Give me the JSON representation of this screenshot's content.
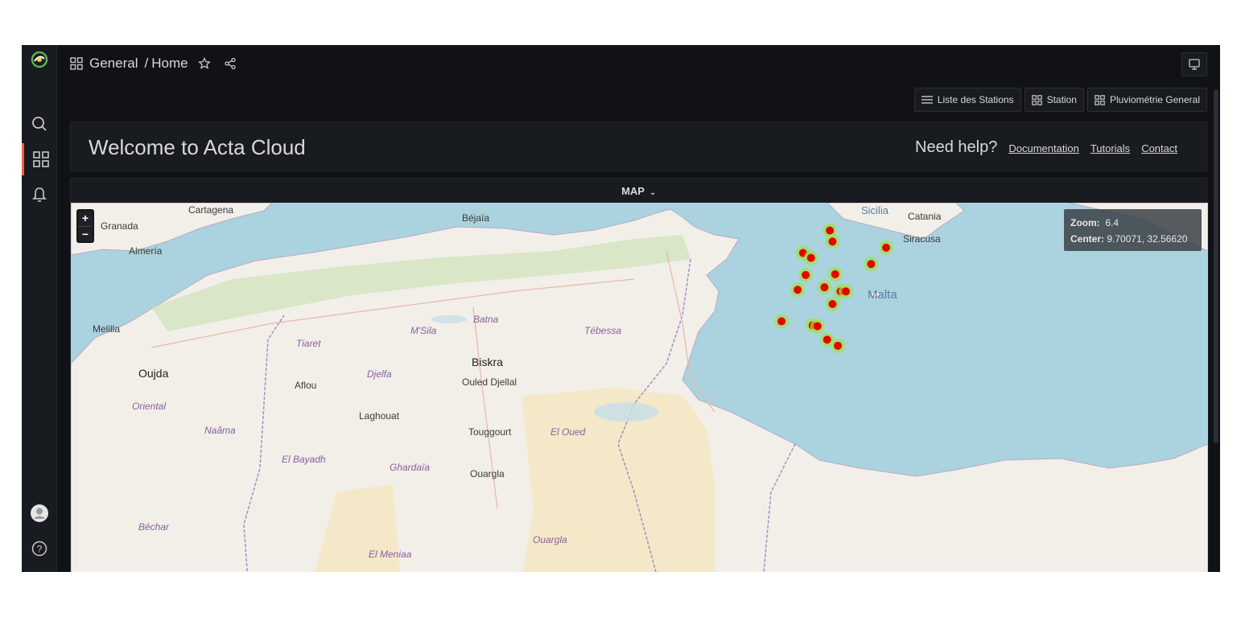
{
  "breadcrumb": {
    "folder": "General",
    "separator": "/",
    "page": "Home"
  },
  "dashlinks": [
    {
      "label": "Liste des Stations",
      "icon": "list-icon"
    },
    {
      "label": "Station",
      "icon": "apps-icon"
    },
    {
      "label": "Pluviométrie General",
      "icon": "apps-icon"
    }
  ],
  "welcome": {
    "title": "Welcome to Acta Cloud",
    "help_label": "Need help?",
    "links": [
      "Documentation",
      "Tutorials",
      "Contact"
    ]
  },
  "map_panel": {
    "title": "MAP",
    "zoom_in": "+",
    "zoom_out": "−",
    "zoom_label": "Zoom:",
    "zoom_value": "6.4",
    "center_label": "Center:",
    "center_value": "9.70071, 32.56620"
  },
  "map_labels": {
    "granada": "Granada",
    "cartagena": "Cartagena",
    "almeria": "Almería",
    "melilla": "Melilla",
    "bejaia": "Béjaïa",
    "biskra": "Biskra",
    "oujda": "Oujda",
    "sicilia": "Sicilia",
    "catania": "Catania",
    "siracusa": "Siracusa",
    "malta": "Malta",
    "tebessa": "Tébessa",
    "msila": "M'Sila",
    "batna": "Batna",
    "tiaret": "Tiaret",
    "djelfa": "Djelfa",
    "aflou": "Aflou",
    "laghouat": "Laghouat",
    "ouled_djellal": "Ouled Djellal",
    "touggourt": "Touggourt",
    "el_oued": "El Oued",
    "ouargla": "Ouargla",
    "ghardaia": "Ghardaïa",
    "el_bayadh": "El Bayadh",
    "naama": "Naâma",
    "oriental": "Oriental",
    "bechar": "Béchar",
    "el_meniaa": "El Meniaa",
    "ouargla2": "Ouargla"
  },
  "heat_points": [
    [
      9.85,
      37.27
    ],
    [
      9.9,
      37.0
    ],
    [
      9.35,
      36.72
    ],
    [
      9.5,
      36.6
    ],
    [
      10.62,
      36.45
    ],
    [
      10.9,
      36.85
    ],
    [
      9.4,
      36.18
    ],
    [
      9.95,
      36.2
    ],
    [
      9.25,
      35.82
    ],
    [
      9.75,
      35.88
    ],
    [
      10.05,
      35.78
    ],
    [
      10.15,
      35.78
    ],
    [
      9.9,
      35.47
    ],
    [
      8.95,
      35.05
    ],
    [
      9.53,
      34.95
    ],
    [
      9.62,
      34.93
    ],
    [
      9.8,
      34.6
    ],
    [
      10.0,
      34.45
    ]
  ],
  "colors": {
    "accent": "#f55f3e",
    "panel": "#181b1f",
    "background": "#111217",
    "sea": "#aad3df",
    "land": "#f2efe9"
  }
}
